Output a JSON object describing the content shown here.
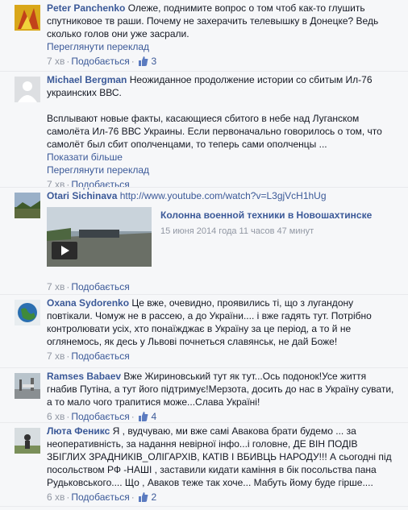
{
  "colors": {
    "link": "#3b5998",
    "meta": "#9197a3",
    "text": "#141823",
    "background": "#f6f7f9"
  },
  "comments": [
    {
      "author": "Peter Panchenko",
      "text": "Олеже, поднимите вопрос о том чтоб как-то глушить спутниковое тв раши. Почему не захерачить телевышку в Донецке? Ведь сколько голов они уже засрали.",
      "translate": "Переглянути переклад",
      "time": "7 хв",
      "like": "Подобається",
      "likes": "3"
    },
    {
      "author": "Michael Bergman",
      "text": "Неожиданное продолжение истории со сбитым Ил-76 украинских ВВС.",
      "text2": "Всплывают новые факты, касающиеся сбитого в небе над Луганском самолёта Ил-76 ВВС Украины. Если первоначально говорилось о том, что самолёт был сбит ополченцами, то теперь сами ополченцы ...",
      "more": "Показати більше",
      "translate": "Переглянути переклад",
      "time": "7 хв",
      "like": "Подобається"
    },
    {
      "author": "Otari Sichinava",
      "url": "http://www.youtube.com/watch?v=L3gjVcH1hUg",
      "video_title": "Колонна военной техники в Новошахтинске",
      "video_date": "15 июня 2014 года 11 часов 47 минут",
      "time": "7 хв",
      "like": "Подобається"
    },
    {
      "author": "Oxana Sydorenko",
      "text": "Це вже, очевидно, проявились ті, що з лугандону повтікали. Чомуж не в рассею, а до України.... і вже гадять тут. Потрібно контролювати усіх, хто понаїжджає в Україну за це період, а то й не оглянемось, як десь у Львові почнеться славянськ, не дай Боже!",
      "time": "7 хв",
      "like": "Подобається"
    },
    {
      "author": "Ramses Babaev",
      "text": "Вже Жириновський тут як тут...Ось подонок!Усе життя гнабив Путіна, а тут його підтримує!Мерзота, досить до нас в Україну сувати, а то мало чого трапитися може...Слава Україні!",
      "time": "6 хв",
      "like": "Подобається",
      "likes": "4"
    },
    {
      "author": "Люта Феникс",
      "text": "Я , вудчуваю, ми вже самі Авакова брати будемо ... за неоперативність, за надання невірної інфо...і головне, ДЕ ВІН ПОДІВ ЗБІГЛИХ ЗРАДНИКІВ_ОЛІГАРХІВ, КАТІВ І ВБИВЦЬ НАРОДУ!!! А сьогодні під посольством РФ -НАШІ , заставили кидати каміння в бік посольства пана Рудьковського.... Що , Аваков теже так хоче... Мабуть йому буде гірше....",
      "time": "6 хв",
      "like": "Подобається",
      "likes": "2"
    }
  ]
}
